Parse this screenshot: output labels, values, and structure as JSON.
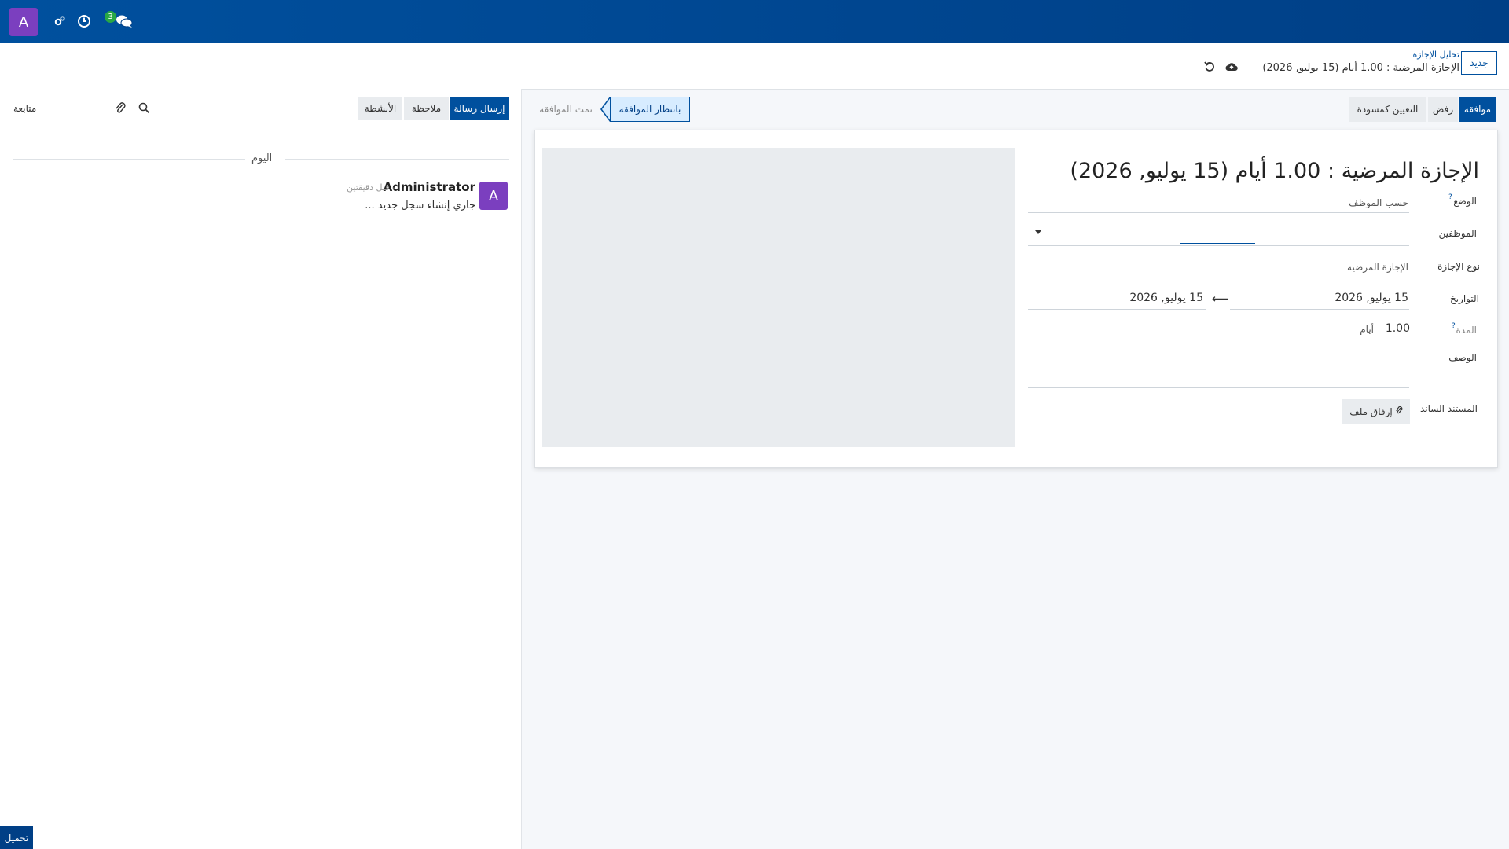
{
  "navbar": {
    "avatar_letter": "A",
    "icons": [
      "gears-icon",
      "clock-icon",
      "chat-bubbles-icon"
    ],
    "message_badge": "3"
  },
  "control_panel": {
    "new_button": "جديد",
    "breadcrumb_parent": "تحليل الإجازة",
    "breadcrumb_current": "الإجازة المرضية : 1.00 أيام (15 يوليو, 2026)",
    "icons": [
      "cloud-upload-icon",
      "undo-icon"
    ]
  },
  "form": {
    "actions": {
      "approve": "موافقة",
      "refuse": "رفض",
      "set_draft": "التعيين كمسودة"
    },
    "statusbar": {
      "current": "بانتظار الموافقة",
      "next": "تمت الموافقة"
    },
    "title": "الإجازة المرضية : 1.00 أيام (15 يوليو, 2026)",
    "fields": {
      "mode_label": "الوضع",
      "mode_help": "?",
      "mode_value": "حسب الموظف",
      "employees_label": "الموظفين",
      "leave_type_label": "نوع الإجازة",
      "leave_type_value": "الإجازة المرضية",
      "dates_label": "التواريخ",
      "date_from": "15 يوليو, 2026",
      "date_to": "15 يوليو, 2026",
      "date_arrow": "⟵",
      "duration_label": "المدة",
      "duration_help": "?",
      "duration_value": "1.00",
      "duration_unit": "أيام",
      "description_label": "الوصف",
      "supporting_doc_label": "المستند الساند",
      "attach_button": "إرفاق ملف"
    }
  },
  "chatter": {
    "send_message": "إرسال رسالة",
    "log_note": "ملاحظة",
    "activities": "الأنشطة",
    "follow": "متابعة",
    "day_separator": "اليوم",
    "message": {
      "avatar_letter": "A",
      "author": "Administrator",
      "time": "- قبل دقيقتين",
      "body": "جاري إنشاء سجل جديد ..."
    },
    "load_button": "تحميل"
  },
  "colors": {
    "primary": "#00509e",
    "navbar": "#003f86",
    "avatar": "#7b3fbf",
    "badge": "#28a745"
  }
}
